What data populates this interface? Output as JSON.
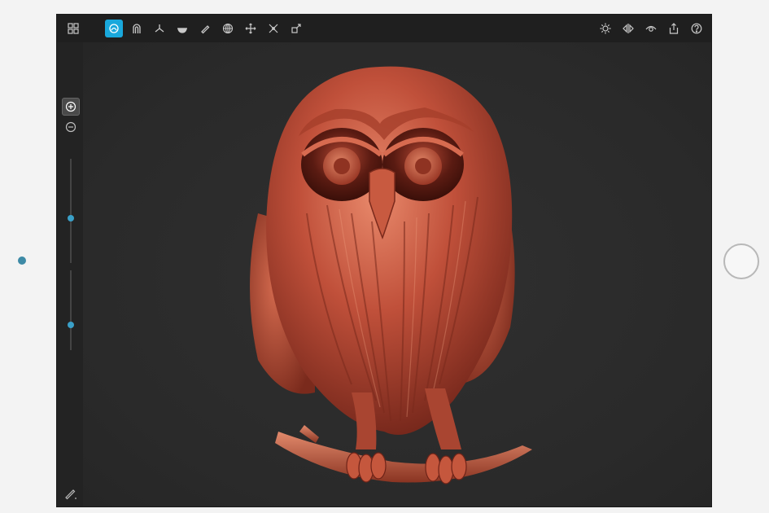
{
  "colors": {
    "accent": "#19a8dc",
    "model_base": "#c0503a",
    "model_highlight": "#e98a6c",
    "model_shadow": "#6e2318"
  },
  "toolbar": {
    "left_icons": [
      "grid-icon",
      "sculpt-brush-icon",
      "magnet-icon",
      "axis-icon",
      "hemisphere-icon",
      "pencil-tool-icon",
      "sphere-grid-icon",
      "move-icon",
      "crease-icon",
      "transform-icon"
    ],
    "right_icons": [
      "settings-icon",
      "symmetry-icon",
      "view-icon",
      "share-icon",
      "help-icon"
    ]
  },
  "sidebar": {
    "icons": [
      "zoom-in-icon",
      "zoom-out-icon",
      "stroke-icon"
    ],
    "radius_slider_value": 0.5,
    "intensity_slider_value": 0.5
  },
  "viewport": {
    "model": "owl-sculpt"
  }
}
